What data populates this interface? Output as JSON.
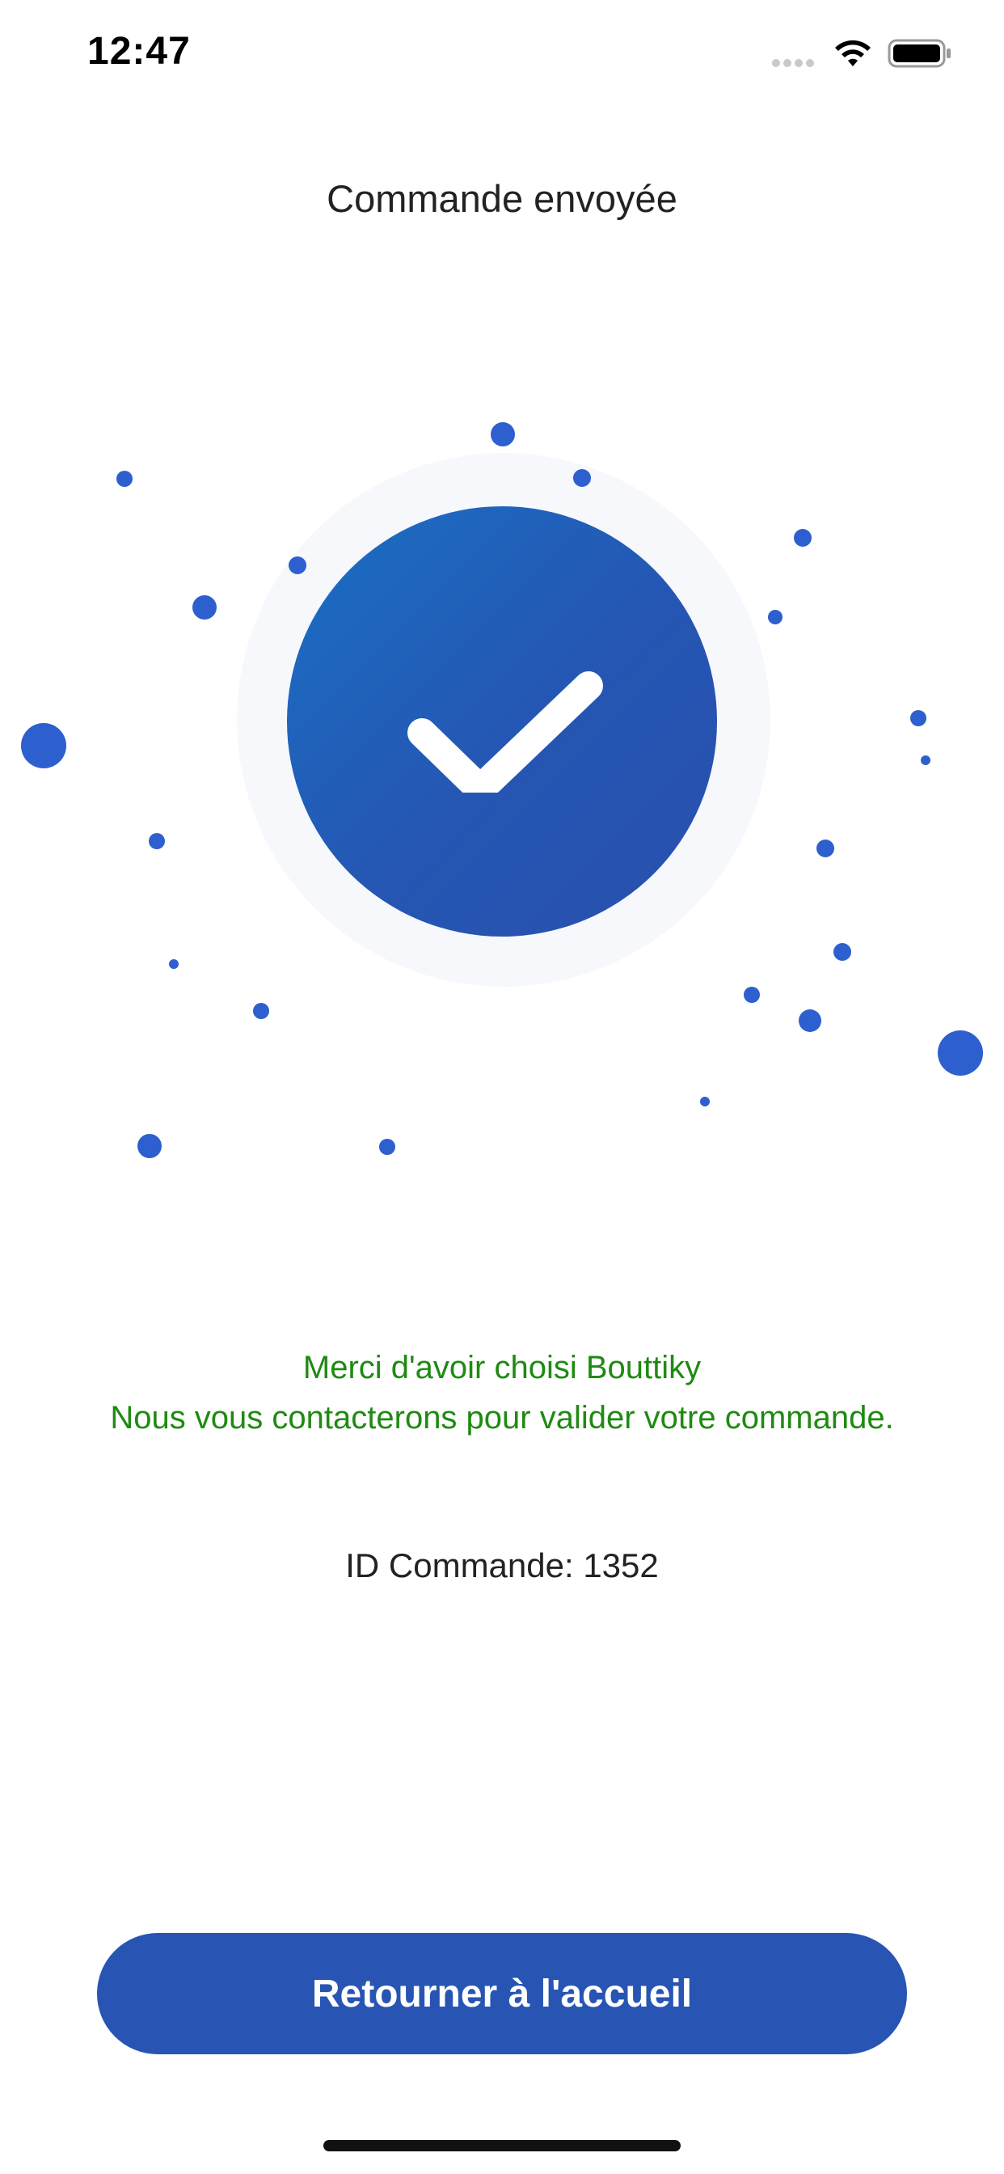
{
  "status_bar": {
    "time": "12:47",
    "icons": [
      "signal-icon",
      "wifi-icon",
      "battery-icon"
    ]
  },
  "header": {
    "title": "Commande envoyée"
  },
  "hero": {
    "icon": "checkmark-icon",
    "accent": "#2855b3"
  },
  "message": {
    "line1": "Merci d'avoir choisi Bouttiky",
    "line2": "Nous vous contacterons pour valider votre commande.",
    "color": "#1f8a12"
  },
  "order": {
    "label": "ID Commande: 1352"
  },
  "actions": {
    "home_button_label": "Retourner à l'accueil"
  }
}
